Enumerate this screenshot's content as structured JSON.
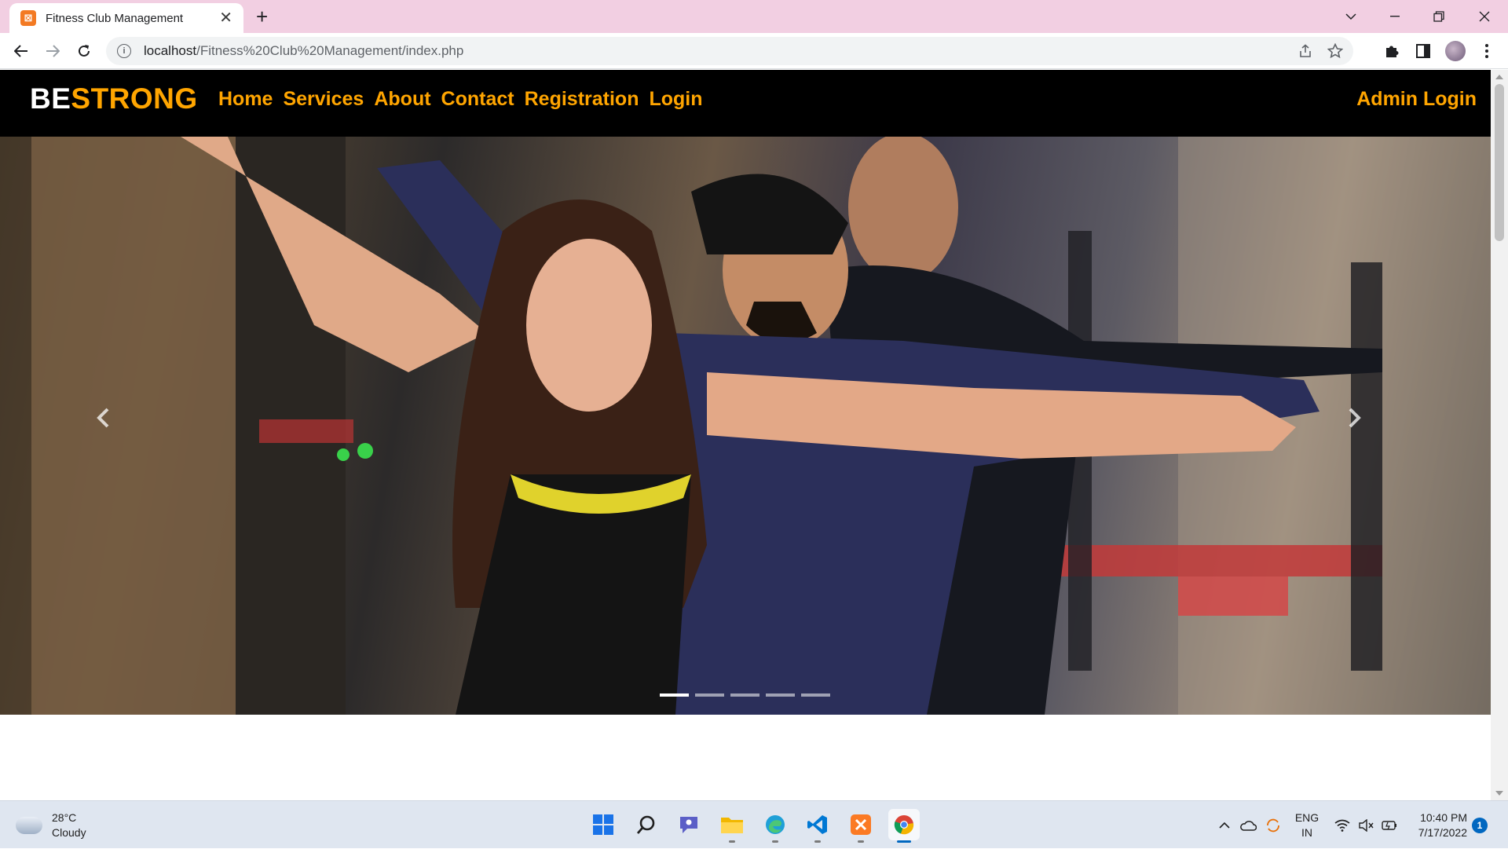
{
  "browser": {
    "tab_title": "Fitness Club Management",
    "tab_close": "✕",
    "new_tab": "+",
    "url_host": "localhost",
    "url_path": "/Fitness%20Club%20Management/index.php"
  },
  "site": {
    "brand_be": "BE",
    "brand_strong": "STRONG",
    "nav": [
      "Home",
      "Services",
      "About",
      "Contact",
      "Registration",
      "Login"
    ],
    "admin_login": "Admin Login",
    "colors": {
      "accent": "#ffa500",
      "nav_bg": "#000000"
    }
  },
  "carousel": {
    "slide_count": 5,
    "active_index": 0
  },
  "taskbar": {
    "weather_temp": "28°C",
    "weather_desc": "Cloudy",
    "lang_top": "ENG",
    "lang_bottom": "IN",
    "time": "10:40 PM",
    "date": "7/17/2022",
    "notifications": "1"
  }
}
